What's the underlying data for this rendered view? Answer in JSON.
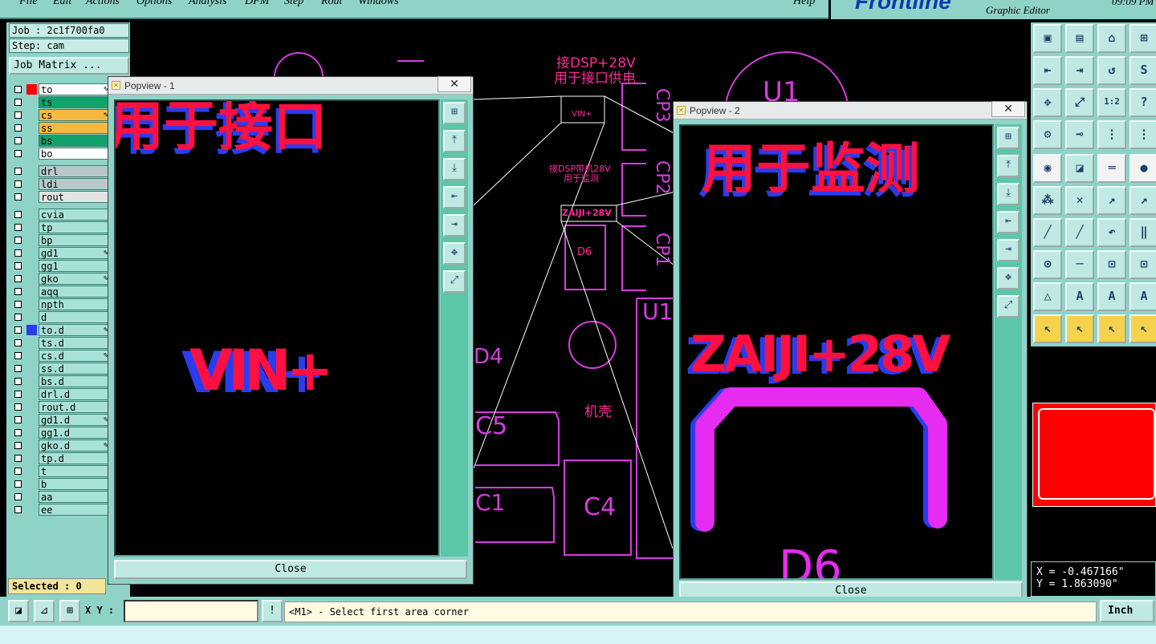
{
  "menubar": {
    "items": [
      "File",
      "Edit",
      "Actions",
      "Options",
      "Analysis",
      "DFM",
      "Step",
      "Rout",
      "Windows"
    ],
    "help": "Help"
  },
  "logo": {
    "brand": "Frontline",
    "subtitle": "Graphic Editor",
    "time": "09:09 PM"
  },
  "job": {
    "job_label": "Job : 2c1f700fa0",
    "step_label": "Step: cam",
    "matrix_button": "Job Matrix ..."
  },
  "layers": [
    {
      "name": "to",
      "color": "#ffffff",
      "sel": "#ff0000",
      "edit": true
    },
    {
      "name": "ts",
      "color": "#12a26a",
      "sel": "",
      "edit": false
    },
    {
      "name": "cs",
      "color": "#f4b93e",
      "sel": "",
      "edit": true
    },
    {
      "name": "ss",
      "color": "#f4b93e",
      "sel": "",
      "edit": false
    },
    {
      "name": "bs",
      "color": "#12a26a",
      "sel": "",
      "edit": false
    },
    {
      "name": "bo",
      "color": "#ffffff",
      "sel": "",
      "edit": false
    },
    {
      "name": "drl",
      "color": "#b8c8cc",
      "sel": "",
      "edit": false
    },
    {
      "name": "ldi",
      "color": "#b8c8cc",
      "sel": "",
      "edit": false
    },
    {
      "name": "rout",
      "color": "#e4e4e4",
      "sel": "",
      "edit": false
    },
    {
      "name": "cvia",
      "color": "#a8e1d8",
      "sel": "",
      "edit": false
    },
    {
      "name": "tp",
      "color": "#a8e1d8",
      "sel": "",
      "edit": false
    },
    {
      "name": "bp",
      "color": "#a8e1d8",
      "sel": "",
      "edit": false
    },
    {
      "name": "gd1",
      "color": "#a8e1d8",
      "sel": "",
      "edit": true
    },
    {
      "name": "gg1",
      "color": "#a8e1d8",
      "sel": "",
      "edit": false
    },
    {
      "name": "gko",
      "color": "#a8e1d8",
      "sel": "",
      "edit": true
    },
    {
      "name": "aqq",
      "color": "#a8e1d8",
      "sel": "",
      "edit": false
    },
    {
      "name": "npth",
      "color": "#a8e1d8",
      "sel": "",
      "edit": false
    },
    {
      "name": "d",
      "color": "#a8e1d8",
      "sel": "",
      "edit": false
    },
    {
      "name": "to.d",
      "color": "#a8e1d8",
      "sel": "#2a3cf0",
      "edit": true
    },
    {
      "name": "ts.d",
      "color": "#a8e1d8",
      "sel": "",
      "edit": false
    },
    {
      "name": "cs.d",
      "color": "#a8e1d8",
      "sel": "",
      "edit": true
    },
    {
      "name": "ss.d",
      "color": "#a8e1d8",
      "sel": "",
      "edit": false
    },
    {
      "name": "bs.d",
      "color": "#a8e1d8",
      "sel": "",
      "edit": false
    },
    {
      "name": "drl.d",
      "color": "#a8e1d8",
      "sel": "",
      "edit": false
    },
    {
      "name": "rout.d",
      "color": "#a8e1d8",
      "sel": "",
      "edit": false
    },
    {
      "name": "gd1.d",
      "color": "#a8e1d8",
      "sel": "",
      "edit": true
    },
    {
      "name": "gg1.d",
      "color": "#a8e1d8",
      "sel": "",
      "edit": false
    },
    {
      "name": "gko.d",
      "color": "#a8e1d8",
      "sel": "",
      "edit": true
    },
    {
      "name": "tp.d",
      "color": "#a8e1d8",
      "sel": "",
      "edit": false
    },
    {
      "name": "t",
      "color": "#a8e1d8",
      "sel": "",
      "edit": false
    },
    {
      "name": "b",
      "color": "#a8e1d8",
      "sel": "",
      "edit": false
    },
    {
      "name": "aa",
      "color": "#a8e1d8",
      "sel": "",
      "edit": false
    },
    {
      "name": "ee",
      "color": "#a8e1d8",
      "sel": "",
      "edit": false
    }
  ],
  "selected": "Selected : 0",
  "canvas": {
    "label_dsp": "接DSP+28V",
    "label_supply": "用于接口供电",
    "label_vin": "VIN+",
    "label_dsp2": "接DSP带机28V",
    "label_monitor": "用于监测",
    "label_zaiji": "ZAIJI+28V",
    "label_d6": "D6",
    "label_u1": "U1",
    "label_u1b": "U1",
    "label_d4": "D4",
    "label_case": "机壳",
    "label_c5": "C5",
    "label_c1": "C1",
    "label_c4": "C4",
    "label_cp3": "CP3",
    "label_cp2": "CP2",
    "label_cp1": "CP1"
  },
  "popview1": {
    "title": "Popview - 1",
    "close_label": "Close",
    "top_text": "用于接口",
    "main_text": "VIN+"
  },
  "popview2": {
    "title": "Popview - 2",
    "close_label": "Close",
    "top_text": "用于监测",
    "main_text": "ZAIJI+28V",
    "bottom_text": "D6"
  },
  "tools": [
    "▣",
    "▤",
    "⌂",
    "⊞",
    "⇤",
    "⇥",
    "↺",
    "S",
    "✥",
    "⤢",
    "1:2",
    "?",
    "⚙",
    "⊸",
    "⋮",
    "⋮",
    "◉",
    "◪",
    "═",
    "●",
    "⁂",
    "✕",
    "↗",
    "↗",
    "╱",
    "╱",
    "↶",
    "‖",
    "⊙",
    "─",
    "⊡",
    "⊡",
    "△",
    "A",
    "A",
    "A",
    "↖",
    "↖",
    "↖",
    "↖"
  ],
  "coords": {
    "x": "X = -0.467166\"",
    "y": "Y = 1.863090\""
  },
  "statusbar": {
    "xy_label": "X Y :",
    "xy_value": "",
    "prompt": "<M1> - Select first area corner",
    "unit": "Inch"
  }
}
